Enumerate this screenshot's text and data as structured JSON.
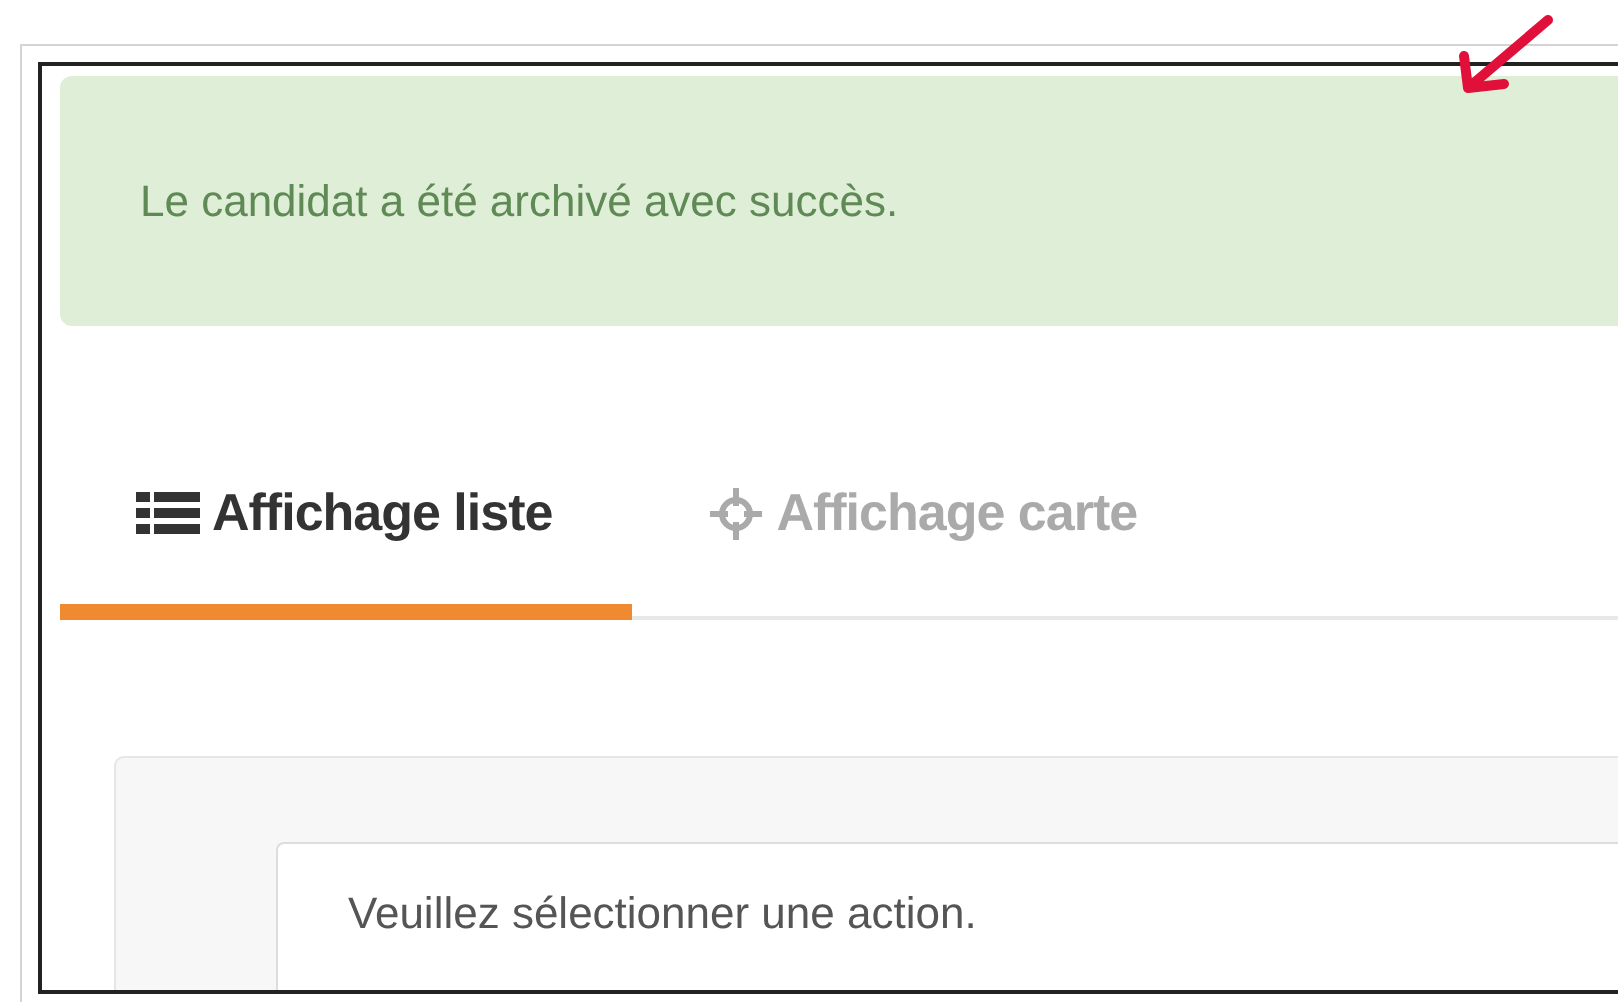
{
  "alert": {
    "message": "Le candidat a été archivé avec succès."
  },
  "tabs": [
    {
      "label": "Affichage liste",
      "kind": "list",
      "selected": true
    },
    {
      "label": "Affichage carte",
      "kind": "crosshair",
      "selected": false
    }
  ],
  "action_select": {
    "value": "Veuillez sélectionner une action."
  }
}
